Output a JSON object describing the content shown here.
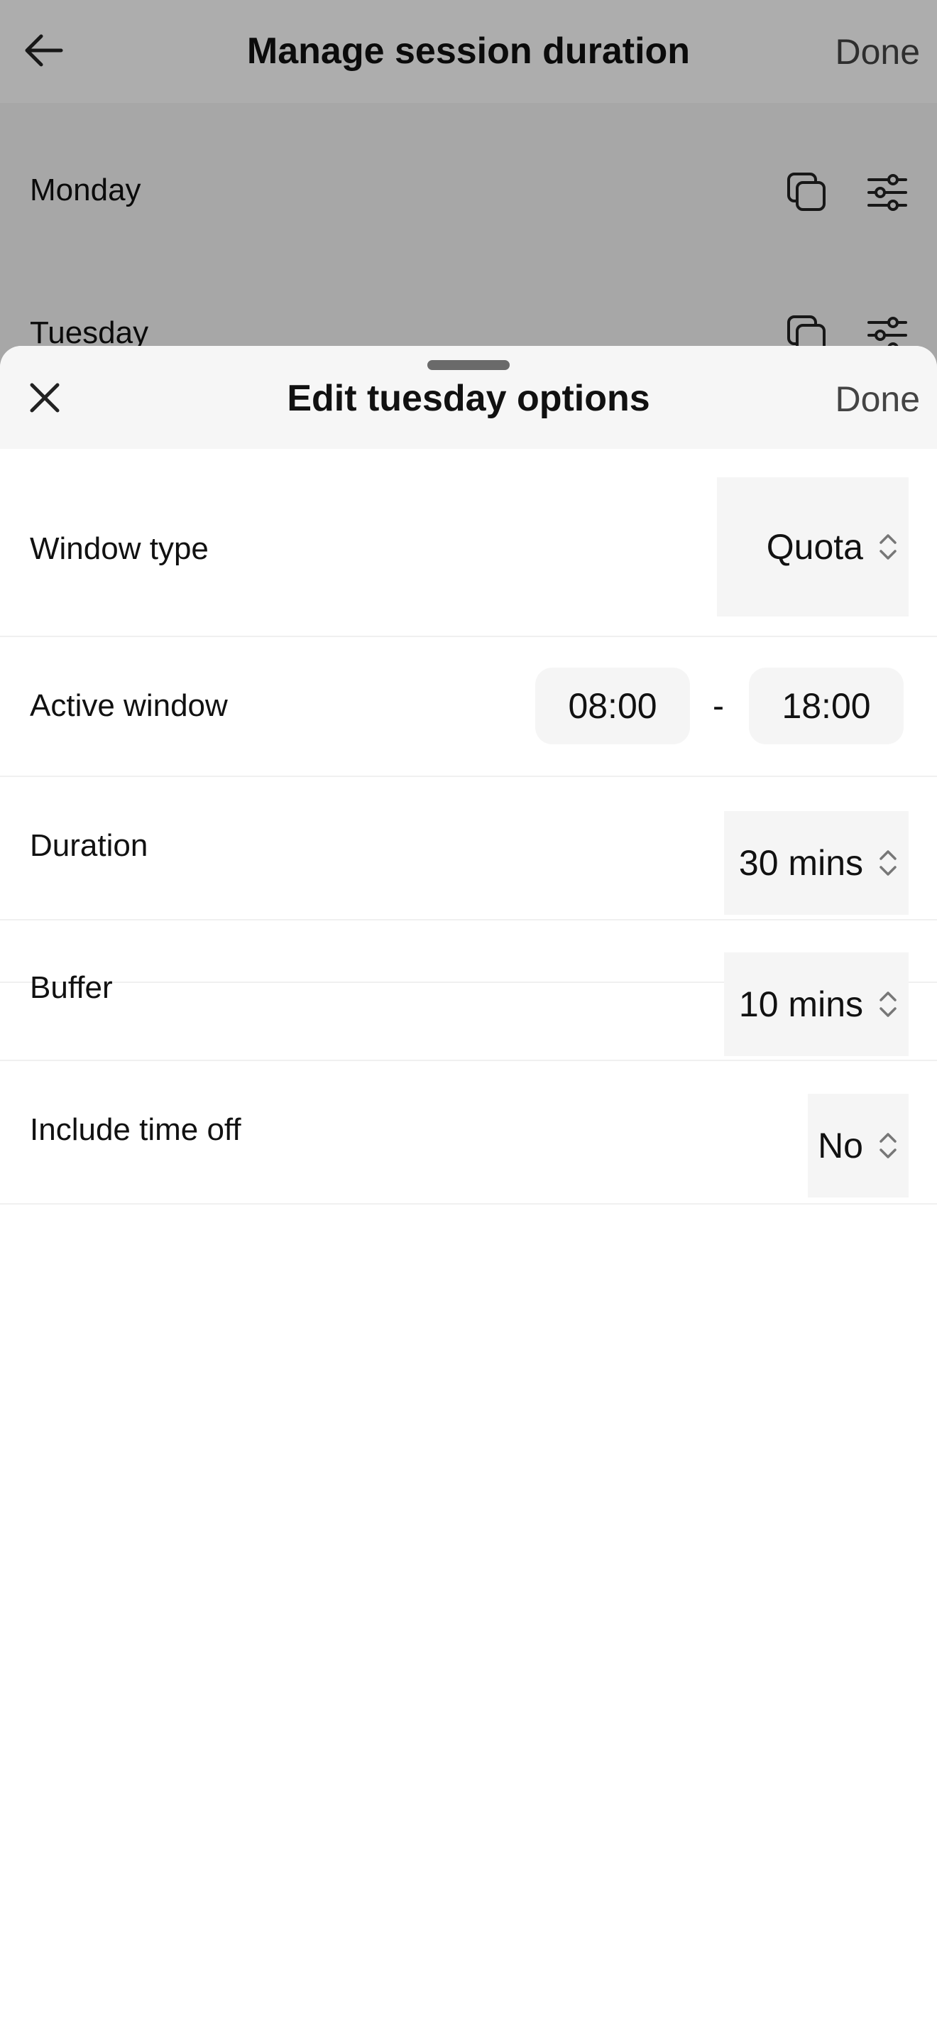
{
  "background": {
    "title": "Manage session duration",
    "done_label": "Done",
    "days": [
      {
        "label": "Monday"
      },
      {
        "label": "Tuesday"
      }
    ]
  },
  "sheet": {
    "title": "Edit tuesday options",
    "done_label": "Done",
    "options": {
      "window_type": {
        "label": "Window type",
        "value": "Quota"
      },
      "active_window": {
        "label": "Active window",
        "start": "08:00",
        "separator": "-",
        "end": "18:00"
      },
      "duration": {
        "label": "Duration",
        "value": "30 mins"
      },
      "buffer": {
        "label": "Buffer",
        "value": "10 mins"
      },
      "include_time_off": {
        "label": "Include time off",
        "value": "No"
      }
    }
  }
}
